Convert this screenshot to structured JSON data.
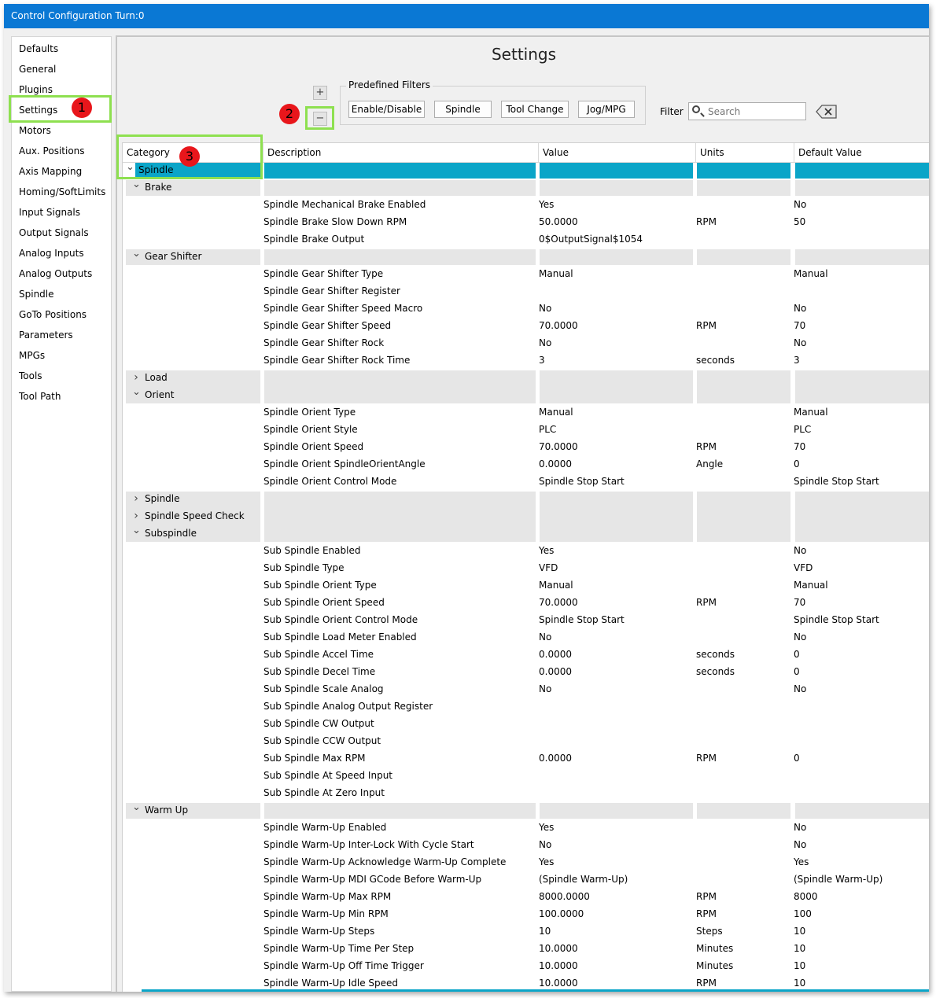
{
  "window": {
    "title": "Control Configuration Turn:0"
  },
  "sidebar": {
    "items": [
      {
        "label": "Defaults"
      },
      {
        "label": "General"
      },
      {
        "label": "Plugins"
      },
      {
        "label": "Settings"
      },
      {
        "label": "Motors"
      },
      {
        "label": "Aux. Positions"
      },
      {
        "label": "Axis Mapping"
      },
      {
        "label": "Homing/SoftLimits"
      },
      {
        "label": "Input Signals"
      },
      {
        "label": "Output Signals"
      },
      {
        "label": "Analog Inputs"
      },
      {
        "label": "Analog Outputs"
      },
      {
        "label": "Spindle"
      },
      {
        "label": "GoTo Positions"
      },
      {
        "label": "Parameters"
      },
      {
        "label": "MPGs"
      },
      {
        "label": "Tools"
      },
      {
        "label": "Tool Path"
      }
    ],
    "selected": "Settings"
  },
  "main": {
    "title": "Settings",
    "expand_glyph": "+",
    "collapse_glyph": "−",
    "filters": {
      "label": "Predefined Filters",
      "buttons": [
        {
          "label": "Enable/Disable"
        },
        {
          "label": "Spindle"
        },
        {
          "label": "Tool Change"
        },
        {
          "label": "Jog/MPG"
        }
      ]
    },
    "filter_label": "Filter",
    "search_placeholder": "Search"
  },
  "callouts": [
    "1",
    "2",
    "3"
  ],
  "grid": {
    "columns": [
      "Category",
      "Description",
      "Value",
      "Units",
      "Default Value"
    ],
    "rows": [
      {
        "type": "cat",
        "level": 0,
        "label": "Spindle",
        "expanded": true,
        "selected": true
      },
      {
        "type": "cat",
        "level": 1,
        "label": "Brake",
        "expanded": true
      },
      {
        "type": "item",
        "desc": "Spindle Mechanical Brake Enabled",
        "value": "Yes",
        "units": "",
        "default": "No"
      },
      {
        "type": "item",
        "desc": "Spindle Brake Slow Down RPM",
        "value": "50.0000",
        "units": "RPM",
        "default": "50"
      },
      {
        "type": "item",
        "desc": "Spindle Brake Output",
        "value": "0$OutputSignal$1054",
        "units": "",
        "default": ""
      },
      {
        "type": "cat",
        "level": 1,
        "label": "Gear Shifter",
        "expanded": true
      },
      {
        "type": "item",
        "desc": "Spindle Gear Shifter Type",
        "value": "Manual",
        "units": "",
        "default": "Manual"
      },
      {
        "type": "item",
        "desc": "Spindle Gear Shifter Register",
        "value": "",
        "units": "",
        "default": ""
      },
      {
        "type": "item",
        "desc": "Spindle Gear Shifter Speed Macro",
        "value": "No",
        "units": "",
        "default": "No"
      },
      {
        "type": "item",
        "desc": "Spindle Gear Shifter Speed",
        "value": "70.0000",
        "units": "RPM",
        "default": "70"
      },
      {
        "type": "item",
        "desc": "Spindle Gear Shifter Rock",
        "value": "No",
        "units": "",
        "default": "No"
      },
      {
        "type": "item",
        "desc": "Spindle Gear Shifter Rock Time",
        "value": "3",
        "units": "seconds",
        "default": "3"
      },
      {
        "type": "cat",
        "level": 1,
        "label": "Load",
        "expanded": false,
        "joinNext": true
      },
      {
        "type": "cat",
        "level": 1,
        "label": "Orient",
        "expanded": true
      },
      {
        "type": "item",
        "desc": "Spindle Orient Type",
        "value": "Manual",
        "units": "",
        "default": "Manual"
      },
      {
        "type": "item",
        "desc": "Spindle Orient Style",
        "value": "PLC",
        "units": "",
        "default": "PLC"
      },
      {
        "type": "item",
        "desc": "Spindle Orient Speed",
        "value": "70.0000",
        "units": "RPM",
        "default": "70"
      },
      {
        "type": "item",
        "desc": "Spindle Orient SpindleOrientAngle",
        "value": "0.0000",
        "units": "Angle",
        "default": "0"
      },
      {
        "type": "item",
        "desc": "Spindle Orient Control Mode",
        "value": "Spindle Stop Start",
        "units": "",
        "default": "Spindle Stop Start"
      },
      {
        "type": "cat",
        "level": 1,
        "label": "Spindle",
        "expanded": false,
        "joinNext": true
      },
      {
        "type": "cat",
        "level": 1,
        "label": "Spindle Speed Check",
        "expanded": false,
        "joinNext": true
      },
      {
        "type": "cat",
        "level": 1,
        "label": "Subspindle",
        "expanded": true
      },
      {
        "type": "item",
        "desc": "Sub Spindle Enabled",
        "value": "Yes",
        "units": "",
        "default": "No"
      },
      {
        "type": "item",
        "desc": "Sub Spindle Type",
        "value": "VFD",
        "units": "",
        "default": "VFD"
      },
      {
        "type": "item",
        "desc": "Sub Spindle Orient Type",
        "value": "Manual",
        "units": "",
        "default": "Manual"
      },
      {
        "type": "item",
        "desc": "Sub Spindle Orient Speed",
        "value": "70.0000",
        "units": "RPM",
        "default": "70"
      },
      {
        "type": "item",
        "desc": "Sub Spindle Orient Control Mode",
        "value": "Spindle Stop Start",
        "units": "",
        "default": "Spindle Stop Start"
      },
      {
        "type": "item",
        "desc": "Sub Spindle Load Meter Enabled",
        "value": "No",
        "units": "",
        "default": "No"
      },
      {
        "type": "item",
        "desc": "Sub Spindle Accel Time",
        "value": "0.0000",
        "units": "seconds",
        "default": "0"
      },
      {
        "type": "item",
        "desc": "Sub Spindle Decel Time",
        "value": "0.0000",
        "units": "seconds",
        "default": "0"
      },
      {
        "type": "item",
        "desc": "Sub Spindle Scale Analog",
        "value": "No",
        "units": "",
        "default": "No"
      },
      {
        "type": "item",
        "desc": "Sub Spindle Analog Output Register",
        "value": "",
        "units": "",
        "default": ""
      },
      {
        "type": "item",
        "desc": "Sub Spindle CW Output",
        "value": "",
        "units": "",
        "default": ""
      },
      {
        "type": "item",
        "desc": "Sub Spindle CCW Output",
        "value": "",
        "units": "",
        "default": ""
      },
      {
        "type": "item",
        "desc": "Sub Spindle Max RPM",
        "value": "0.0000",
        "units": "RPM",
        "default": "0"
      },
      {
        "type": "item",
        "desc": "Sub Spindle At Speed Input",
        "value": "",
        "units": "",
        "default": ""
      },
      {
        "type": "item",
        "desc": "Sub Spindle At Zero Input",
        "value": "",
        "units": "",
        "default": ""
      },
      {
        "type": "cat",
        "level": 1,
        "label": "Warm Up",
        "expanded": true
      },
      {
        "type": "item",
        "desc": "Spindle Warm-Up Enabled",
        "value": "Yes",
        "units": "",
        "default": "No"
      },
      {
        "type": "item",
        "desc": "Spindle Warm-Up Inter-Lock With Cycle Start",
        "value": "No",
        "units": "",
        "default": "No"
      },
      {
        "type": "item",
        "desc": "Spindle Warm-Up Acknowledge Warm-Up Complete",
        "value": "Yes",
        "units": "",
        "default": "Yes"
      },
      {
        "type": "item",
        "desc": "Spindle Warm-Up MDI GCode Before Warm-Up",
        "value": "(Spindle Warm-Up)",
        "units": "",
        "default": "(Spindle Warm-Up)"
      },
      {
        "type": "item",
        "desc": "Spindle Warm-Up Max RPM",
        "value": "8000.0000",
        "units": "RPM",
        "default": "8000"
      },
      {
        "type": "item",
        "desc": "Spindle Warm-Up Min RPM",
        "value": "100.0000",
        "units": "RPM",
        "default": "100"
      },
      {
        "type": "item",
        "desc": "Spindle Warm-Up Steps",
        "value": "10",
        "units": "Steps",
        "default": "10"
      },
      {
        "type": "item",
        "desc": "Spindle Warm-Up Time Per Step",
        "value": "10.0000",
        "units": "Minutes",
        "default": "10"
      },
      {
        "type": "item",
        "desc": "Spindle Warm-Up Off Time Trigger",
        "value": "10.0000",
        "units": "Minutes",
        "default": "10"
      },
      {
        "type": "item",
        "desc": "Spindle Warm-Up Idle Speed",
        "value": "10.0000",
        "units": "RPM",
        "default": "10"
      }
    ]
  }
}
